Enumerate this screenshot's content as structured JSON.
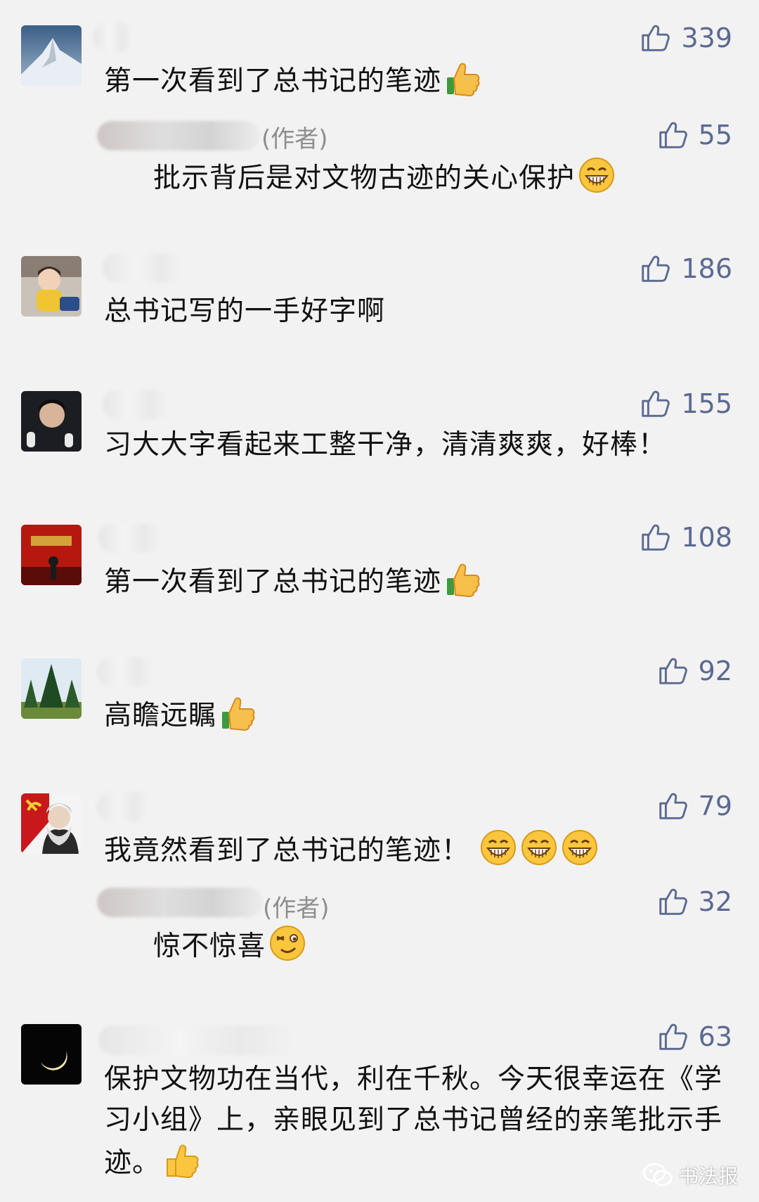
{
  "comments": [
    {
      "likes": "339",
      "text": "第一次看到了总书记的笔迹",
      "emoji": "thumbs-up"
    },
    {
      "reply": true,
      "author_tag": "(作者)",
      "likes": "55",
      "text": "批示背后是对文物古迹的关心保护",
      "emoji": "grin"
    },
    {
      "likes": "186",
      "text": "总书记写的一手好字啊"
    },
    {
      "likes": "155",
      "text": "习大大字看起来工整干净，清清爽爽，好棒！"
    },
    {
      "likes": "108",
      "text": "第一次看到了总书记的笔迹",
      "emoji": "thumbs-up"
    },
    {
      "likes": "92",
      "text": "高瞻远瞩",
      "emoji": "thumbs-up"
    },
    {
      "likes": "79",
      "text": "我竟然看到了总书记的笔迹！",
      "emoji": "grin-x3"
    },
    {
      "reply": true,
      "author_tag": "(作者)",
      "likes": "32",
      "text": "惊不惊喜",
      "emoji": "wink"
    },
    {
      "likes": "63",
      "text": "保护文物功在当代，利在千秋。今天很幸运在《学习小组》上，亲眼见到了总书记曾经的亲笔批示手迹。",
      "emoji": "thumbs-up-yellow"
    }
  ],
  "watermark": {
    "text": "书法报",
    "icon": "wechat-icon"
  },
  "colors": {
    "likes": "#5b6a91",
    "background": "#f2f2f2",
    "text": "#111111"
  }
}
